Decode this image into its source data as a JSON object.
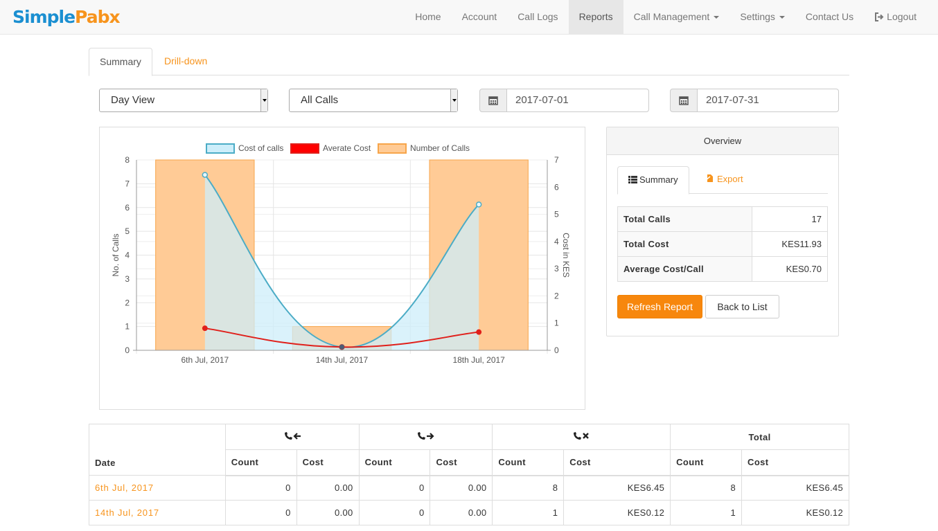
{
  "navbar": {
    "brand_part1": "Simple",
    "brand_part2": "Pabx",
    "items": [
      {
        "label": "Home"
      },
      {
        "label": "Account"
      },
      {
        "label": "Call Logs"
      },
      {
        "label": "Reports",
        "active": true
      },
      {
        "label": "Call Management",
        "dropdown": true
      },
      {
        "label": "Settings",
        "dropdown": true
      },
      {
        "label": "Contact Us"
      },
      {
        "label": "Logout",
        "icon": "logout-icon"
      }
    ]
  },
  "tabs": {
    "summary": "Summary",
    "drilldown": "Drill-down"
  },
  "filters": {
    "view": "Day View",
    "call_type": "All Calls",
    "date_from": "2017-07-01",
    "date_to": "2017-07-31"
  },
  "chart_data": {
    "type": "bar",
    "categories": [
      "6th Jul, 2017",
      "14th Jul, 2017",
      "18th Jul, 2017"
    ],
    "series": [
      {
        "name": "Cost of calls",
        "type": "area",
        "axis": "right",
        "color": "#4bacc6",
        "fill": "#cdeefa",
        "values": [
          6.45,
          0.12,
          5.36
        ]
      },
      {
        "name": "Averate Cost",
        "type": "line",
        "axis": "right",
        "color": "#e0201b",
        "fill": "#ff0000",
        "values": [
          0.81,
          0.12,
          0.67
        ]
      },
      {
        "name": "Number of Calls",
        "type": "bar",
        "axis": "left",
        "color": "#f7a54a",
        "fill": "#ffcb96",
        "values": [
          8,
          1,
          8
        ]
      }
    ],
    "ylabel": "No. of Calls",
    "y2label": "Cost in KES",
    "ylim": [
      0,
      8
    ],
    "y2lim": [
      0,
      7
    ],
    "yticks": [
      "0",
      "1",
      "2",
      "3",
      "4",
      "5",
      "6",
      "7",
      "8"
    ],
    "y2ticks": [
      "0",
      "1",
      "2",
      "3",
      "4",
      "5",
      "6",
      "7"
    ],
    "legend": "top"
  },
  "overview": {
    "title": "Overview",
    "tab_summary": "Summary",
    "tab_export": "Export",
    "rows": [
      {
        "label": "Total Calls",
        "value": "17"
      },
      {
        "label": "Total Cost",
        "value": "KES11.93"
      },
      {
        "label": "Average Cost/Call",
        "value": "KES0.70"
      }
    ],
    "refresh_label": "Refresh Report",
    "back_label": "Back to List"
  },
  "table": {
    "date_header": "Date",
    "groups": [
      {
        "icon": "incoming-call-icon"
      },
      {
        "icon": "outgoing-call-icon"
      },
      {
        "icon": "missed-call-icon"
      },
      {
        "label": "Total"
      }
    ],
    "count_label": "Count",
    "cost_label": "Cost",
    "rows": [
      {
        "date": "6th Jul, 2017",
        "values": [
          "0",
          "0.00",
          "0",
          "0.00",
          "8",
          "KES6.45",
          "8",
          "KES6.45"
        ]
      },
      {
        "date": "14th Jul, 2017",
        "values": [
          "0",
          "0.00",
          "0",
          "0.00",
          "1",
          "KES0.12",
          "1",
          "KES0.12"
        ]
      }
    ]
  }
}
